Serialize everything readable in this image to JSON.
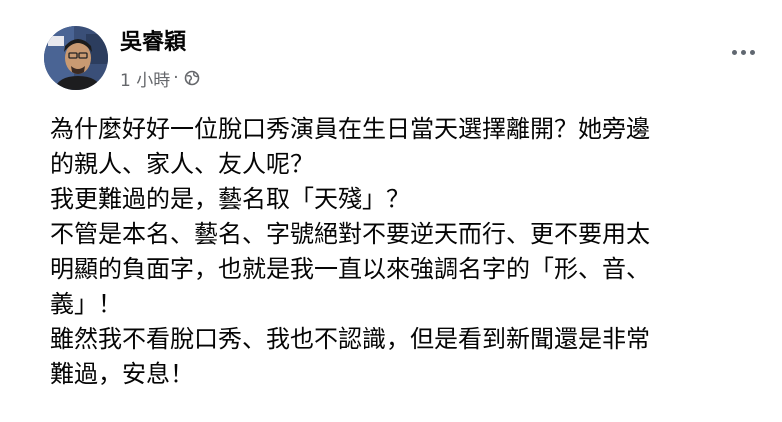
{
  "post": {
    "author": "吳睿穎",
    "timestamp": "1 小時",
    "separator": "·",
    "audience_icon": "globe-icon",
    "more_icon": "more-options-icon",
    "lines": [
      "為什麼好好一位脫口秀演員在生日當天選擇離開？她旁邊",
      "的親人、家人、友人呢？",
      "我更難過的是，藝名取「天殘」？",
      "不管是本名、藝名、字號絕對不要逆天而行、更不要用太",
      "明顯的負面字，也就是我一直以來強調名字的「形、音、",
      "義」！",
      "雖然我不看脫口秀、我也不認識，但是看到新聞還是非常",
      "難過，安息！"
    ]
  },
  "colors": {
    "text": "#050505",
    "secondary": "#65676b"
  }
}
